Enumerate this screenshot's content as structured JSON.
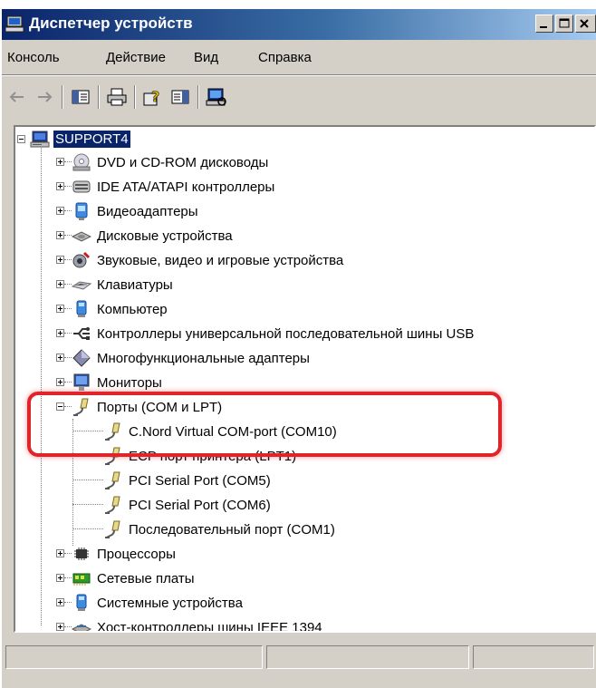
{
  "window": {
    "title": "Диспетчер устройств",
    "icon": "device-manager-icon",
    "colors": {
      "title_start": "#0a246a",
      "title_end": "#a6caf0",
      "face": "#d4d0c8",
      "selection": "#0a246a",
      "highlight": "#e0252a"
    }
  },
  "menu": [
    "Консоль",
    "Действие",
    "Вид",
    "Справка"
  ],
  "toolbar": {
    "buttons": [
      "back-icon",
      "forward-icon",
      "show-hide-console-tree-icon",
      "print-icon",
      "help-icon",
      "properties-icon",
      "scan-hardware-icon"
    ]
  },
  "tree": {
    "root": {
      "label": "SUPPORT4",
      "icon": "computer-icon",
      "selected": true
    },
    "categories": [
      {
        "label": "DVD и CD-ROM дисководы",
        "icon": "cdrom-icon",
        "expanded": false
      },
      {
        "label": "IDE ATA/ATAPI контроллеры",
        "icon": "ide-controller-icon",
        "expanded": false
      },
      {
        "label": "Видеоадаптеры",
        "icon": "display-adapter-icon",
        "expanded": false
      },
      {
        "label": "Дисковые устройства",
        "icon": "disk-drive-icon",
        "expanded": false
      },
      {
        "label": "Звуковые, видео и игровые устройства",
        "icon": "sound-icon",
        "expanded": false
      },
      {
        "label": "Клавиатуры",
        "icon": "keyboard-icon",
        "expanded": false
      },
      {
        "label": "Компьютер",
        "icon": "computer-category-icon",
        "expanded": false
      },
      {
        "label": "Контроллеры универсальной последовательной шины USB",
        "icon": "usb-icon",
        "expanded": false
      },
      {
        "label": "Многофункциональные адаптеры",
        "icon": "multifunction-adapter-icon",
        "expanded": false
      },
      {
        "label": "Мониторы",
        "icon": "monitor-icon",
        "expanded": false
      },
      {
        "label": "Порты (COM и LPT)",
        "icon": "port-icon",
        "expanded": true,
        "children": [
          "C.Nord Virtual COM-port (COM10)",
          "ECP порт принтера (LPT1)",
          "PCI Serial Port (COM5)",
          "PCI Serial Port (COM6)",
          "Последовательный порт (COM1)"
        ]
      },
      {
        "label": "Процессоры",
        "icon": "processor-icon",
        "expanded": false
      },
      {
        "label": "Сетевые платы",
        "icon": "network-adapter-icon",
        "expanded": false
      },
      {
        "label": "Системные устройства",
        "icon": "system-device-icon",
        "expanded": false
      },
      {
        "label": "Хост-контроллеры шины IEEE 1394",
        "icon": "ieee1394-icon",
        "expanded": false
      }
    ]
  }
}
